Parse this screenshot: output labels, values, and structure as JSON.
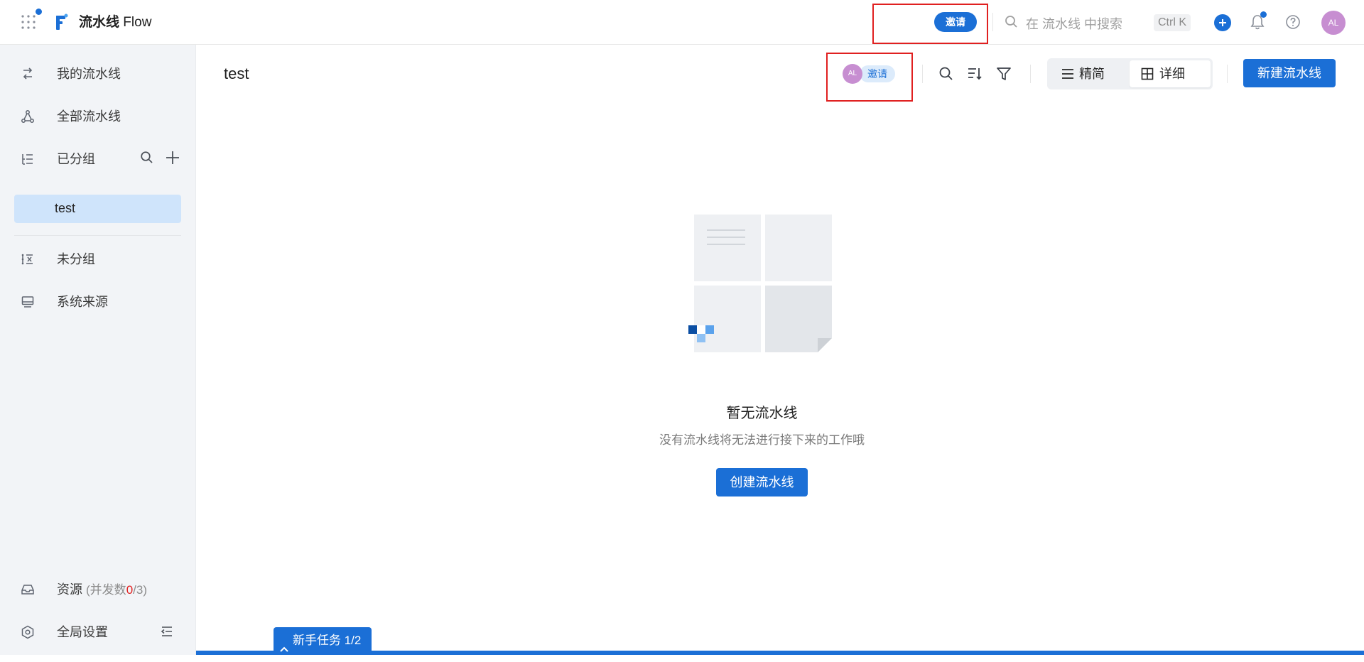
{
  "colors": {
    "accent": "#1b6fd6",
    "highlight_box": "#e02020",
    "avatar": "#c78ed1",
    "sidebar_bg": "#f2f4f7",
    "selected_group_bg": "#cfe4fb"
  },
  "app": {
    "title_cn": "流水线",
    "title_en": "Flow"
  },
  "topbar": {
    "invite_label": "邀请",
    "search_placeholder": "在 流水线 中搜索",
    "shortcut": "Ctrl K",
    "avatar_initials": "AL",
    "icons": [
      "apps-grid-icon",
      "search-icon",
      "plus-icon",
      "bell-icon",
      "help-icon"
    ]
  },
  "sidebar": {
    "my_pipelines": "我的流水线",
    "all_pipelines": "全部流水线",
    "grouped": "已分组",
    "groups": [
      {
        "label": "test",
        "selected": true
      }
    ],
    "ungrouped": "未分组",
    "system_source": "系统来源",
    "resources_label": "资源",
    "resources_quota_prefix": "(并发数",
    "resources_used": "0",
    "resources_suffix": "/3)",
    "global_settings": "全局设置"
  },
  "main": {
    "title": "test",
    "invite_avatar": "AL",
    "invite_label": "邀请",
    "view_compact": "精简",
    "view_detail": "详细",
    "active_view": "详细",
    "new_pipeline": "新建流水线",
    "empty_title": "暂无流水线",
    "empty_subtitle": "没有流水线将无法进行接下来的工作哦",
    "create_pipeline": "创建流水线"
  },
  "footer": {
    "task_label": "新手任务 1/2"
  }
}
